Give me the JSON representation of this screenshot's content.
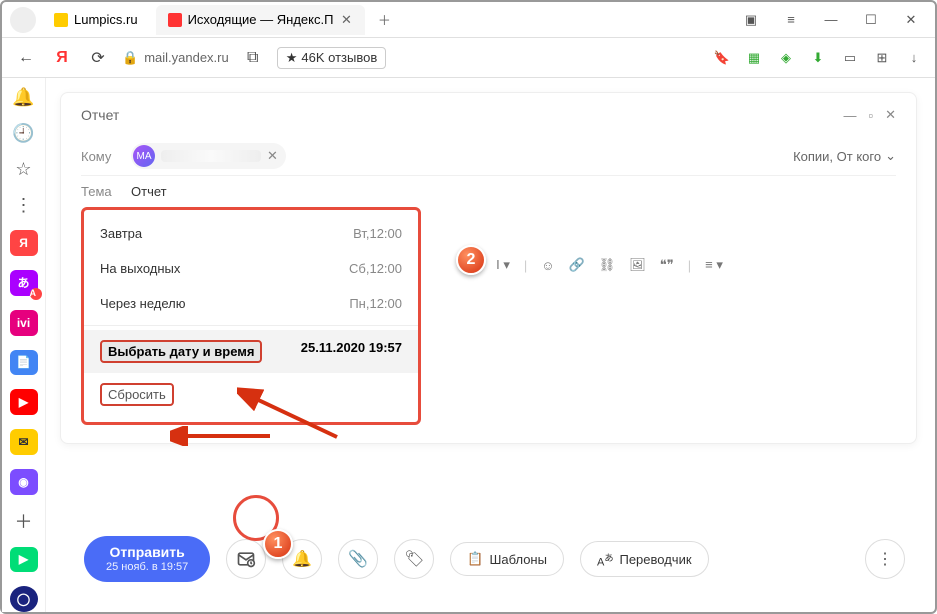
{
  "browser": {
    "tabs": [
      {
        "label": "Lumpics.ru"
      },
      {
        "label": "Исходящие — Яндекс.П"
      }
    ],
    "url": "mail.yandex.ru",
    "rating": "46K отзывов"
  },
  "compose": {
    "title": "Отчет",
    "to_label": "Кому",
    "recipient_initials": "MA",
    "copies_label": "Копии, От кого",
    "subject_label": "Тема",
    "subject_value": "Отчет"
  },
  "schedule": {
    "items": [
      {
        "label": "Завтра",
        "time": "Вт,12:00"
      },
      {
        "label": "На выходных",
        "time": "Сб,12:00"
      },
      {
        "label": "Через неделю",
        "time": "Пн,12:00"
      }
    ],
    "pick_label": "Выбрать дату и время",
    "pick_value": "25.11.2020 19:57",
    "reset_label": "Сбросить"
  },
  "actions": {
    "send_label": "Отправить",
    "send_time": "25 нояб. в 19:57",
    "templates_label": "Шаблоны",
    "translator_label": "Переводчик"
  },
  "markers": {
    "m1": "1",
    "m2": "2"
  }
}
